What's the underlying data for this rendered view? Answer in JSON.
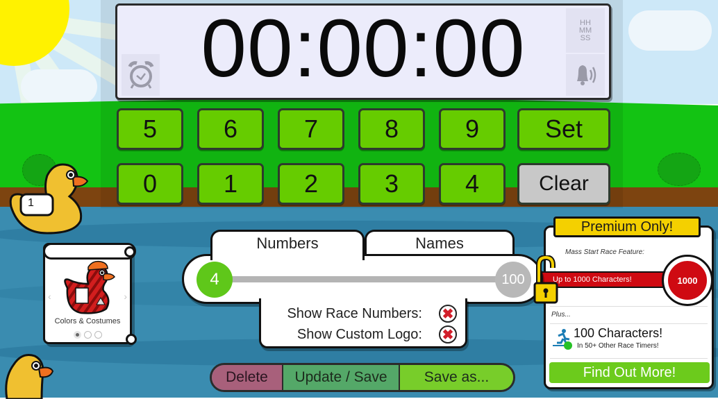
{
  "timer": {
    "display": "00:00:00",
    "format_label_lines": [
      "HH",
      "MM",
      "SS"
    ],
    "alarm_icon": "alarm-clock-icon",
    "sound_icon": "bell-sound-icon"
  },
  "keypad": {
    "row1": [
      "5",
      "6",
      "7",
      "8",
      "9"
    ],
    "row2": [
      "0",
      "1",
      "2",
      "3",
      "4"
    ],
    "set_label": "Set",
    "clear_label": "Clear"
  },
  "racers": {
    "tabs": [
      {
        "label": "Numbers",
        "active": true
      },
      {
        "label": "Names",
        "active": false
      }
    ],
    "slider": {
      "min_label": "4",
      "max_label": "100",
      "value": 4,
      "max": 100
    },
    "options": [
      {
        "label": "Show Race Numbers:",
        "enabled": false
      },
      {
        "label": "Show Custom Logo:",
        "enabled": false
      }
    ]
  },
  "actions": {
    "delete_label": "Delete",
    "update_label": "Update / Save",
    "save_as_label": "Save as..."
  },
  "costume_card": {
    "label": "Colors & Costumes",
    "prev_arrow": "‹",
    "next_arrow": "›",
    "pages": 3,
    "current_page": 1
  },
  "premium": {
    "banner": "Premium Only!",
    "mass_label": "Mass Start Race Feature:",
    "bar_text": "Up to 1000 Characters!",
    "bulb_value": "1000",
    "plus_label": "Plus...",
    "characters_title": "100 Characters!",
    "characters_sub": "In 50+ Other Race Timers!",
    "cta_label": "Find Out More!"
  },
  "ducks": [
    {
      "number": "1"
    }
  ],
  "colors": {
    "key_green": "#66cc00",
    "clear_grey": "#c8c8c8",
    "premium_yellow": "#f4d000",
    "premium_red": "#cf0a12",
    "cta_green": "#6ccb1c"
  }
}
